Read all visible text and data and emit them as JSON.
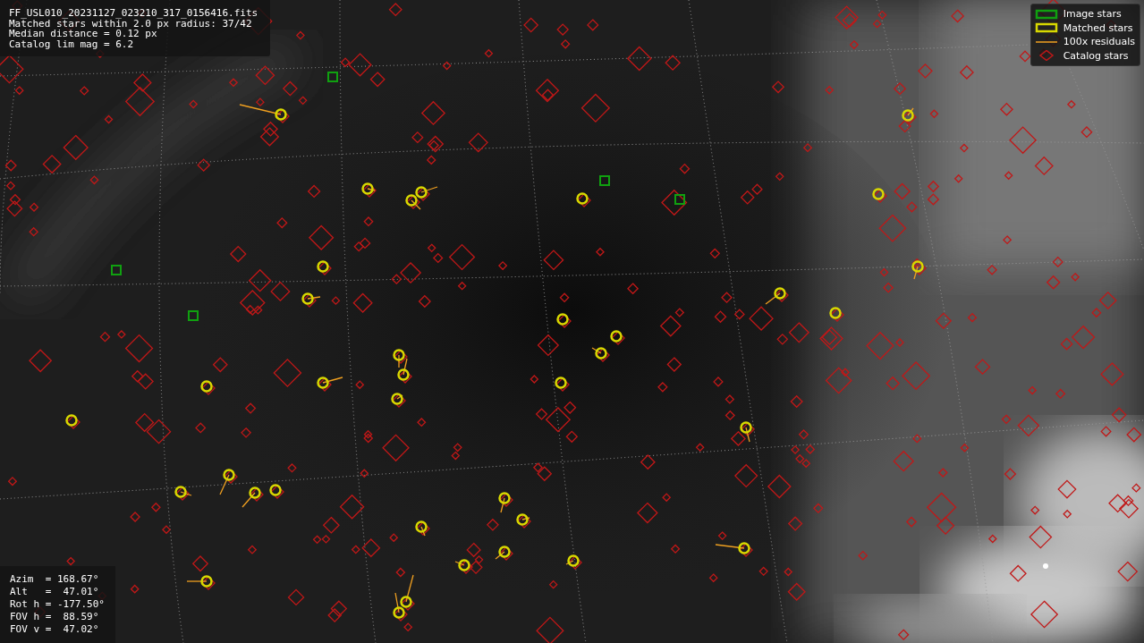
{
  "info_panel": {
    "lines": [
      "FF_USL010_20231127_023210_317_0156416.fits",
      "Matched stars within 2.0 px radius: 37/42",
      "Median distance = 0.12 px",
      "Catalog lim mag = 6.2"
    ]
  },
  "legend": {
    "items": [
      {
        "label": "Image stars"
      },
      {
        "kind": "matched",
        "label": "Matched stars"
      },
      {
        "kind": "residual",
        "label": "100x residuals"
      },
      {
        "kind": "catalog",
        "label": "Catalog stars"
      }
    ]
  },
  "pointing_panel": {
    "lines": [
      "Azim  = 168.67°",
      "Alt   =  47.01°",
      "Rot h = -177.50°",
      "FOV h =  88.59°",
      "FOV v =  47.02°"
    ]
  },
  "image": {
    "kind": "sky"
  }
}
